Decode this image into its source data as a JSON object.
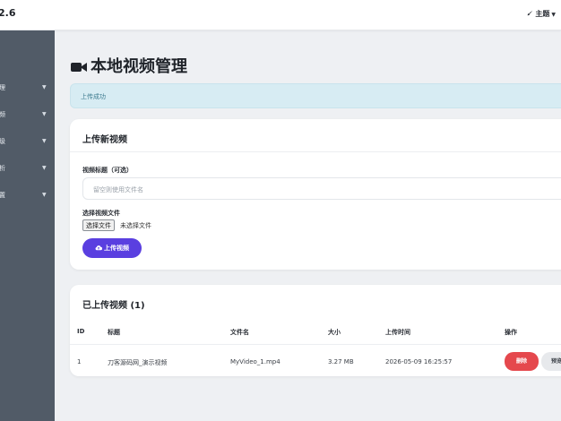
{
  "header": {
    "brand": "2.6",
    "theme_label": "主题",
    "theme_icon": "brush-icon"
  },
  "sidebar": {
    "items": [
      {
        "label": "理"
      },
      {
        "label": "频"
      },
      {
        "label": "级"
      },
      {
        "label": "析"
      },
      {
        "label": "置"
      }
    ]
  },
  "page": {
    "title": "本地视频管理",
    "title_icon": "video-camera-icon"
  },
  "alert": {
    "text": "上传成功"
  },
  "upload_card": {
    "title": "上传新视频",
    "title_label": "视频标题（可选）",
    "title_placeholder": "留空则使用文件名",
    "file_label": "选择视频文件",
    "file_button": "选择文件",
    "file_status": "未选择文件",
    "submit": "上传视频",
    "submit_icon": "cloud-upload-icon"
  },
  "list_card": {
    "title": "已上传视频 (1)",
    "columns": [
      "ID",
      "标题",
      "文件名",
      "大小",
      "上传时间",
      "操作"
    ],
    "rows": [
      {
        "id": "1",
        "title": "刀客源码网_演示视频",
        "filename": "MyVideo_1.mp4",
        "size": "3.27 MB",
        "uploaded": "2026-05-09 16:25:57",
        "delete_label": "删除",
        "preview_label": "预览"
      }
    ]
  },
  "colors": {
    "accent": "#5a3fe0",
    "danger": "#e5484d",
    "sidebar": "#515b67",
    "alert_bg": "#d7ecf3"
  }
}
